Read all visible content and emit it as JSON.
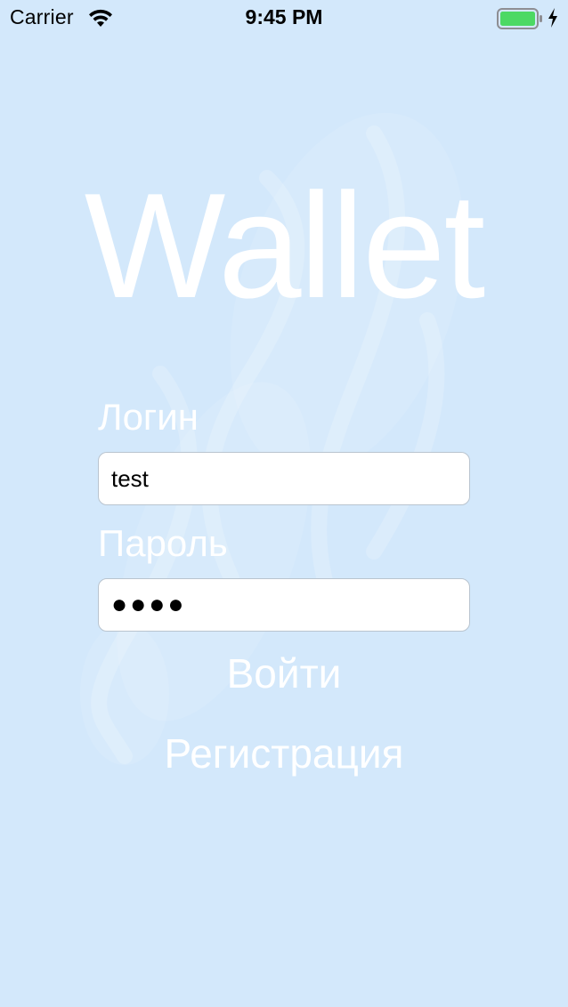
{
  "status_bar": {
    "carrier": "Carrier",
    "time": "9:45 PM",
    "wifi_icon": "wifi-icon",
    "battery_icon": "battery-icon",
    "charging_icon": "bolt-icon",
    "battery_color": "#4cd964"
  },
  "app": {
    "title": "Wallet",
    "background_color": "#d3e8fb"
  },
  "login_form": {
    "login_label": "Логин",
    "login_value": "test",
    "password_label": "Пароль",
    "password_value": "●●●●",
    "submit_label": "Войти",
    "register_label": "Регистрация"
  }
}
